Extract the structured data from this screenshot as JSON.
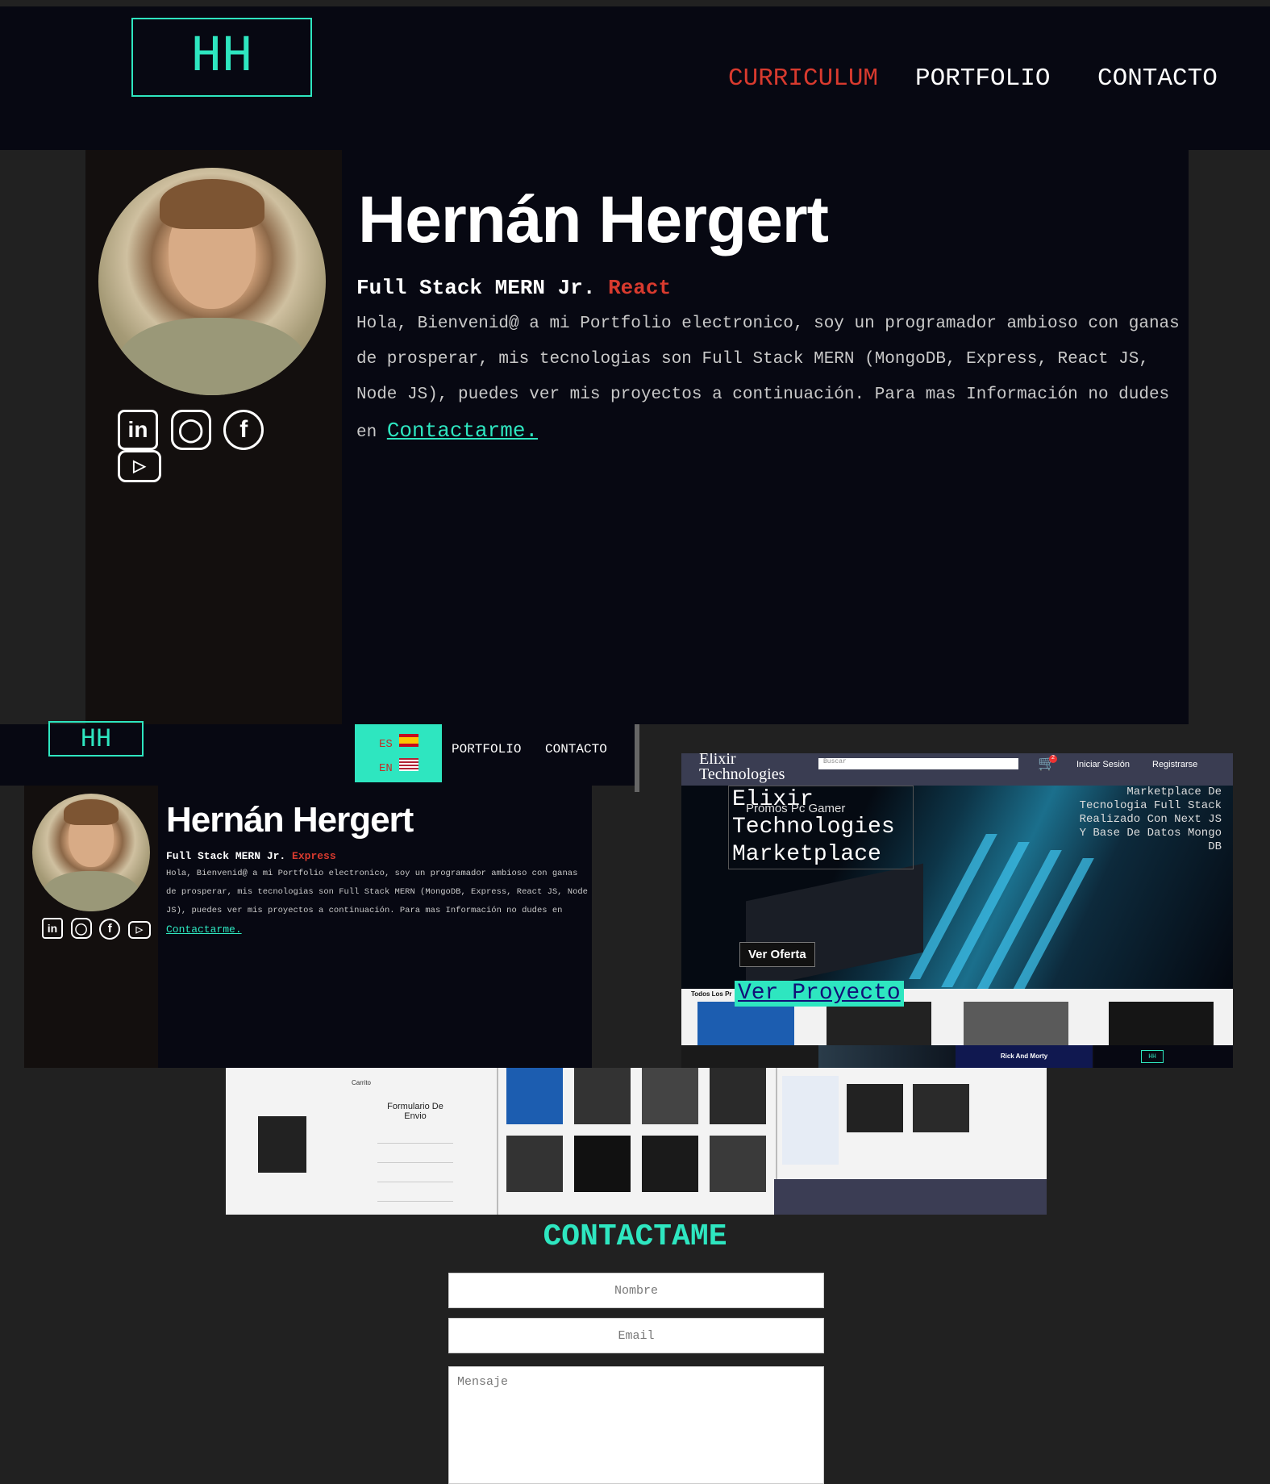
{
  "logo": "HH",
  "nav": {
    "curriculum": "CURRICULUM",
    "portfolio": "PORTFOLIO",
    "contacto": "CONTACTO"
  },
  "hero": {
    "name": "Hernán Hergert",
    "subtitle": "Full Stack MERN Jr.",
    "role_react": "React",
    "role_express": "Express",
    "intro": "Hola, Bienvenid@ a mi Portfolio electronico, soy un programador ambioso con ganas de prosperar, mis tecnologias son Full Stack MERN (MongoDB, Express, React JS, Node JS), puedes ver mis proyectos a continuación. Para mas Información no dudes en ",
    "contact_link": "Contactarme."
  },
  "socials": [
    "linkedin-icon",
    "instagram-icon",
    "facebook-icon",
    "youtube-icon"
  ],
  "lang": {
    "es": "ES",
    "en": "EN"
  },
  "portfolio": {
    "project_title": "Elixir Technologies Marketplace",
    "brand": "Elixir Technologies",
    "promo": "Promos Pc Gamer",
    "search_placeholder": "Buscar",
    "cart_count": "2",
    "login": "Iniciar Sesión",
    "register": "Registrarse",
    "overlay_desc": "Marketplace De Tecnologia Full Stack Realizado Con Next JS Y Base De Datos Mongo DB",
    "offer_button": "Ver Oferta",
    "category": "Todos Los Pr",
    "view_button": "Ver Proyecto",
    "other_project": "Rick And Morty"
  },
  "form_preview": {
    "title": "Formulario De Envio",
    "cart_title": "Carrito"
  },
  "contact": {
    "title": "CONTACTAME",
    "name_placeholder": "Nombre",
    "email_placeholder": "Email",
    "message_placeholder": "Mensaje"
  },
  "colors": {
    "accent": "#2ee6c0",
    "active": "#d83a2e",
    "navy": "#070812",
    "bg": "#212121"
  }
}
